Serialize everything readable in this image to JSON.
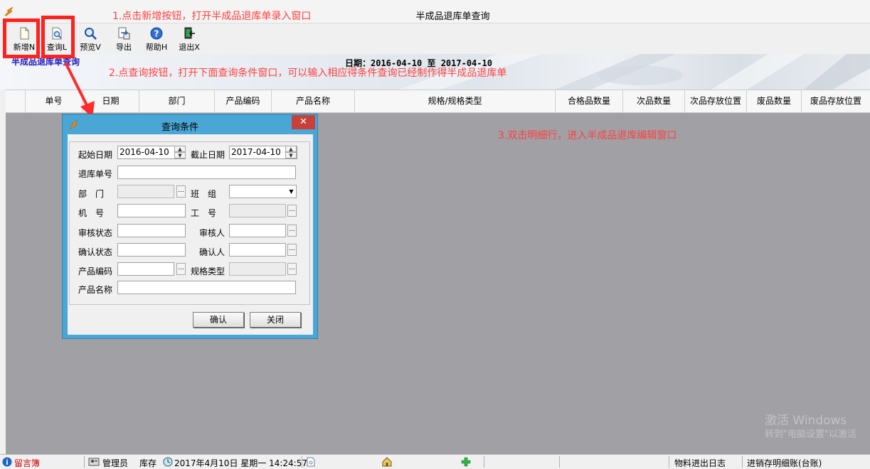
{
  "window": {
    "title": "半成品退库单查询"
  },
  "toolbar": [
    {
      "name": "new-button",
      "icon": "new-document-icon",
      "label": "新增N"
    },
    {
      "name": "query-button",
      "icon": "query-icon",
      "label": "查询L"
    },
    {
      "name": "preview-button",
      "icon": "magnifier-icon",
      "label": "预览V"
    },
    {
      "name": "export-button",
      "icon": "export-icon",
      "label": "导出"
    },
    {
      "name": "help-button",
      "icon": "help-icon",
      "label": "帮助H"
    },
    {
      "name": "exit-button",
      "icon": "exit-icon",
      "label": "退出X"
    }
  ],
  "banner": {
    "title": "半成品退库单查询",
    "date_range": "日期：2016-04-10 至 2017-04-10"
  },
  "grid": {
    "columns": [
      "单号",
      "日期",
      "部门",
      "产品编码",
      "产品名称",
      "规格/规格类型",
      "合格品数量",
      "次品数量",
      "次品存放位置",
      "废品数量",
      "废品存放位置"
    ]
  },
  "annotations": {
    "step1": "1.点击新增按钮，打开半成品退库单录入窗口",
    "step2": "2.点查询按钮，打开下面查询条件窗口，可以输入相应得条件查询已经制作得半成品退库单",
    "step3": "3.双击明细行，进入半成品退库编辑窗口",
    "color": "#ff4040"
  },
  "dialog": {
    "title": "查询条件",
    "close_symbol": "✕",
    "fields": {
      "start_date_label": "起始日期",
      "start_date_value": "2016-04-10",
      "end_date_label": "截止日期",
      "end_date_value": "2017-04-10",
      "return_no_label": "退库单号",
      "dept_label": "部　门",
      "team_label": "班　组",
      "machine_label": "机　号",
      "worker_label": "工　号",
      "audit_status_label": "审核状态",
      "auditor_label": "审核人",
      "confirm_status_label": "确认状态",
      "confirmer_label": "确认人",
      "product_code_label": "产品编码",
      "spec_type_label": "规格类型",
      "product_name_label": "产品名称"
    },
    "ok_label": "确认",
    "close_label": "关闭"
  },
  "statusbar": {
    "guestbook": "留言簿",
    "user": "管理员",
    "module": "库存",
    "datetime": "2017年4月10日 星期一 14:24:57",
    "log": "物料进出日志",
    "ledger": "进销存明细账(台账)"
  },
  "watermark": {
    "line1": "激活 Windows",
    "line2": "转到\"电脑设置\"以激活"
  }
}
